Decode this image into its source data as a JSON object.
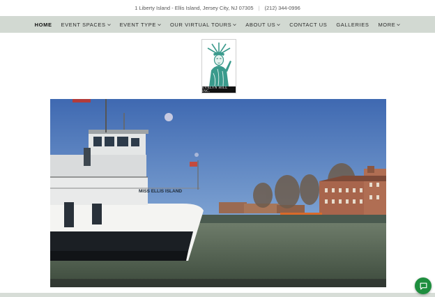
{
  "topbar": {
    "address": "1 Liberty Island - Ellis Island, Jersey City, NJ 07305",
    "separator": "|",
    "phone": "(212) 344-0996"
  },
  "nav": {
    "items": [
      {
        "label": "HOME",
        "active": true,
        "dropdown": false
      },
      {
        "label": "EVENT SPACES",
        "active": false,
        "dropdown": true
      },
      {
        "label": "EVENT TYPE",
        "active": false,
        "dropdown": true
      },
      {
        "label": "OUR VIRTUAL TOURS",
        "active": false,
        "dropdown": true
      },
      {
        "label": "ABOUT US",
        "active": false,
        "dropdown": true
      },
      {
        "label": "CONTACT US",
        "active": false,
        "dropdown": false
      },
      {
        "label": "GALLERIES",
        "active": false,
        "dropdown": false
      },
      {
        "label": "MORE",
        "active": false,
        "dropdown": true
      }
    ]
  },
  "logo": {
    "caption": "EVELYN HILL INC."
  },
  "hero": {
    "boat_name": "MISS ELLIS ISLAND"
  },
  "chat": {
    "icon": "chat-bubble-icon",
    "color": "#1e8e3e"
  },
  "colors": {
    "nav_background": "#d2d9d2",
    "logo_teal": "#3a9a8c"
  }
}
